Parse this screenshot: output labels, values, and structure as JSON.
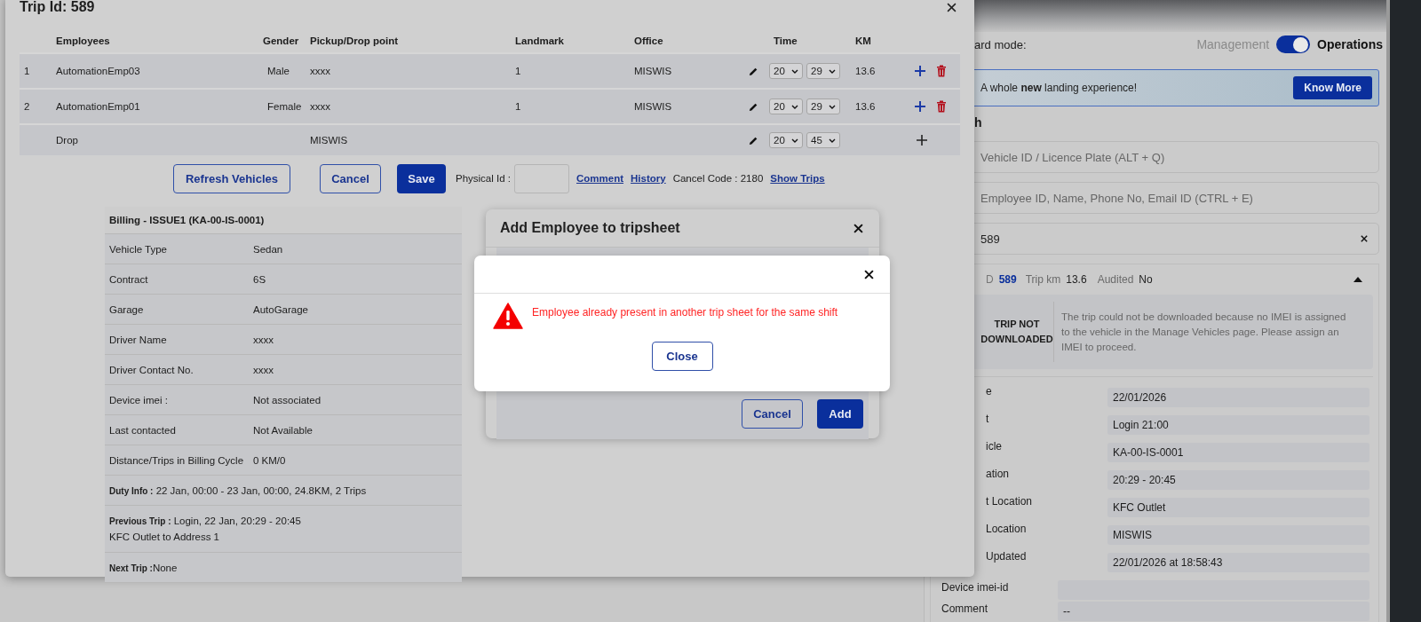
{
  "trip_dialog": {
    "title": "Trip Id: 589",
    "columns": [
      "Employees",
      "Gender",
      "Pickup/Drop point",
      "Landmark",
      "Office",
      "Time",
      "KM"
    ],
    "rows": [
      {
        "kind": "employee",
        "index": "1",
        "employee": "AutomationEmp03",
        "gender": "Male",
        "point": "xxxx",
        "landmark": "1",
        "office": "MISWIS",
        "hour": "20",
        "minute": "29",
        "km": "13.6"
      },
      {
        "kind": "employee",
        "index": "2",
        "employee": "AutomationEmp01",
        "gender": "Female",
        "point": "xxxx",
        "landmark": "1",
        "office": "MISWIS",
        "hour": "20",
        "minute": "29",
        "km": "13.6"
      },
      {
        "kind": "drop",
        "employee": "Drop",
        "point": "MISWIS",
        "hour": "20",
        "minute": "45"
      }
    ],
    "buttons": [
      "Refresh Vehicles",
      "Cancel",
      "Save"
    ],
    "physical_id_label": "Physical Id :",
    "links": [
      "Comment",
      "History"
    ],
    "cancel_code": "Cancel Code : 2180",
    "show_trips": "Show Trips",
    "billing": {
      "title": "Billing - ISSUE1 (KA-00-IS-0001)",
      "rows": [
        {
          "label": "Vehicle Type",
          "value": "Sedan"
        },
        {
          "label": "Contract",
          "value": "6S"
        },
        {
          "label": "Garage",
          "value": "AutoGarage"
        },
        {
          "label": "Driver Name",
          "value": "xxxx"
        },
        {
          "label": "Driver Contact No.",
          "value": "xxxx"
        },
        {
          "label": "Device imei :",
          "value": "Not associated"
        },
        {
          "label": "Last contacted",
          "value": "Not Available"
        },
        {
          "label": "Distance/Trips in Billing Cycle",
          "value": "0 KM/0"
        }
      ],
      "duty_info": {
        "label": "Duty Info :",
        "value": "22 Jan, 00:00 - 23 Jan, 00:00, 24.8KM, 2 Trips"
      },
      "previous_trip": {
        "label": "Previous Trip :",
        "value": "Login, 22 Jan, 20:29 - 20:45",
        "route": "KFC Outlet to Address 1"
      },
      "next_trip": {
        "label": "Next Trip :",
        "value": "None"
      }
    }
  },
  "add_employee_dialog": {
    "title": "Add Employee to tripsheet",
    "buttons": [
      "Cancel",
      "Add"
    ]
  },
  "alert": {
    "message": "Employee already present in another trip sheet for the same shift",
    "button": "Close"
  },
  "right_panel": {
    "mode_label": "ard mode:",
    "mode_options": [
      {
        "label": "Management",
        "selected": false
      },
      {
        "label": "Operations",
        "selected": true
      }
    ],
    "banner": {
      "text": "A whole **new** landing experience!",
      "button": "Know More"
    },
    "section_title": "h",
    "search_fields": [
      {
        "placeholder": "Vehicle ID / Licence Plate (ALT + Q)"
      },
      {
        "placeholder": "Employee ID, Name, Phone No, Email ID (CTRL + E)"
      },
      {
        "value": "589"
      }
    ],
    "trip_card": {
      "id_label": "D",
      "id": "589",
      "km_label": "Trip km",
      "km": "13.6",
      "audited_label": "Audited",
      "audited": "No",
      "expanded": true,
      "status": "TRIP NOT DOWNLOADED",
      "note": "The trip could not be downloaded because no IMEI is assigned to the vehicle in the Manage Vehicles page. Please assign an IMEI to proceed.",
      "details": [
        {
          "label": "e",
          "value": "22/01/2026"
        },
        {
          "label": "t",
          "value": "Login 21:00"
        },
        {
          "label": "icle",
          "value": "KA-00-IS-0001"
        },
        {
          "label": "ation",
          "value": "20:29 - 20:45"
        },
        {
          "label": "t Location",
          "value": "KFC Outlet"
        },
        {
          "label": "Location",
          "value": "MISWIS"
        },
        {
          "label": "Updated",
          "value": "22/01/2026 at 18:58:43"
        },
        {
          "label": "Device imei-id"
        },
        {
          "label": "Comment",
          "value": "--"
        }
      ]
    }
  }
}
